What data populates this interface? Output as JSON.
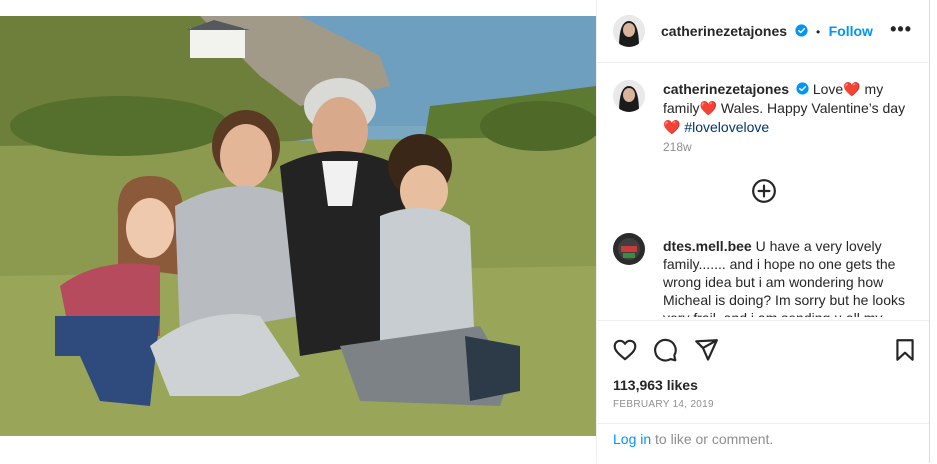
{
  "post": {
    "username": "catherinezetajones",
    "follow_label": "Follow",
    "separator": "•",
    "more_label": "•••",
    "caption": {
      "username": "catherinezetajones",
      "part1": "Love",
      "part2": "my family",
      "part3": "Wales. Happy Valentine’s day",
      "hashtag": "#lovelovelove",
      "heart": "❤️"
    },
    "time_ago": "218w",
    "comment": {
      "username": "dtes.mell.bee",
      "text": "U have a very lovely family....... and i hope no one gets the wrong idea but i am wondering how Micheal is doing? Im sorry but he looks very frail, and i am sending u all my"
    },
    "likes": "113,963 likes",
    "date": "FEBRUARY 14, 2019",
    "login": {
      "link": "Log in",
      "rest": " to like or comment."
    }
  },
  "colors": {
    "link_blue": "#0095f6",
    "verified_blue": "#0095f6",
    "heart_red": "#ed1c24",
    "hashtag": "#00376b",
    "muted": "#8e8e8e"
  },
  "icons": [
    "verified-icon",
    "more-options-icon",
    "add-comment-icon",
    "heart-icon",
    "comment-icon",
    "share-icon",
    "bookmark-icon"
  ]
}
